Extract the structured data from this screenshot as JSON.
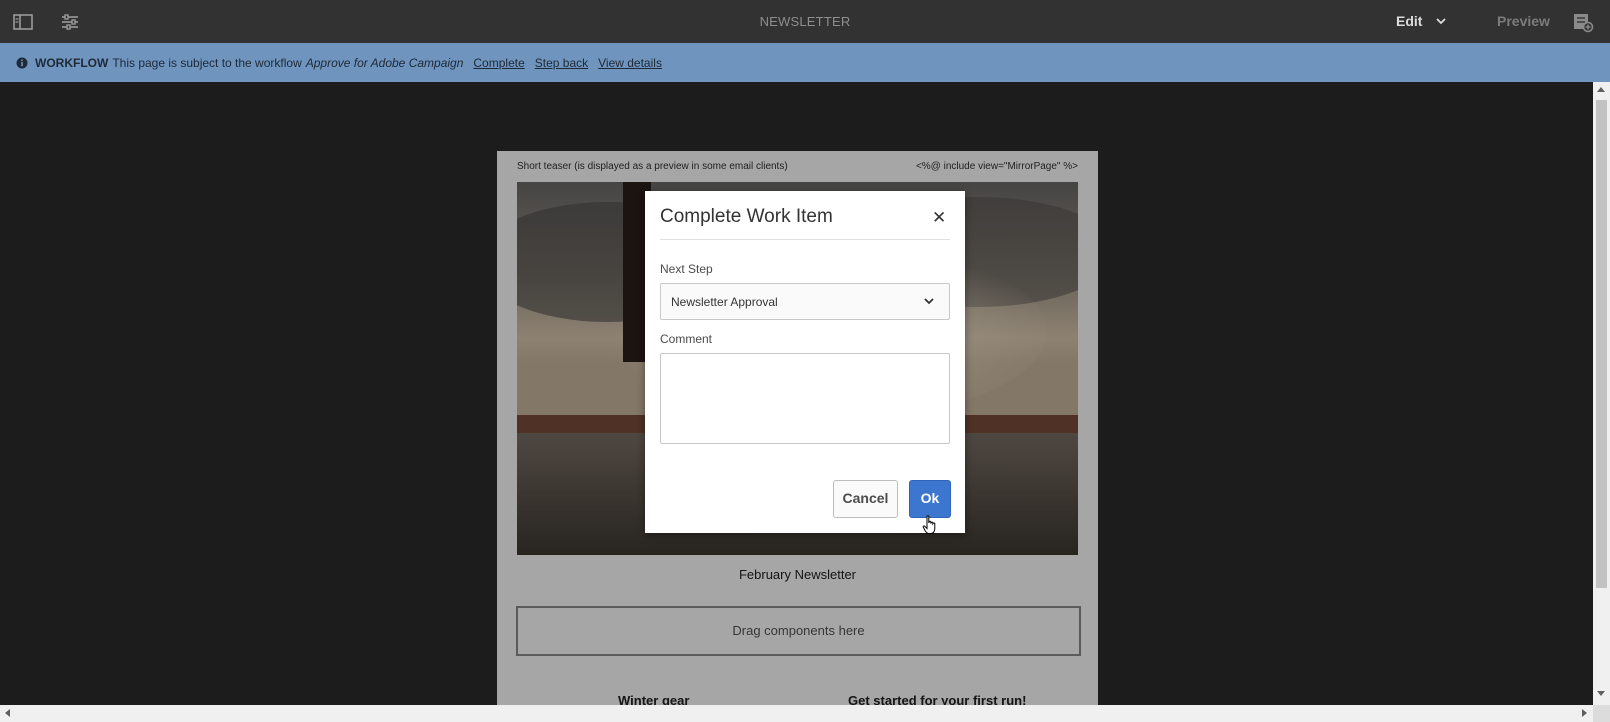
{
  "topbar": {
    "title": "NEWSLETTER",
    "edit_label": "Edit",
    "preview_label": "Preview",
    "icons": [
      "side-panel-icon",
      "page-properties-icon",
      "chevron-down-icon",
      "annotations-icon"
    ]
  },
  "workflow": {
    "label": "WORKFLOW",
    "text": "This page is subject to the workflow",
    "workflow_name": "Approve for Adobe Campaign",
    "links": {
      "complete": "Complete",
      "step_back": "Step back",
      "view_details": "View details"
    }
  },
  "page": {
    "teaser": "Short teaser (is displayed as a preview in some email clients)",
    "mirror": "<%@ include view=\"MirrorPage\" %>",
    "caption": "February Newsletter",
    "dropzone": "Drag components here",
    "col1": "Winter gear",
    "col2": "Get started for your first run!"
  },
  "dialog": {
    "title": "Complete Work Item",
    "next_step_label": "Next Step",
    "next_step_value": "Newsletter Approval",
    "comment_label": "Comment",
    "comment_value": "",
    "cancel_label": "Cancel",
    "ok_label": "Ok"
  },
  "colors": {
    "topbar": "#323232",
    "workflow_bar": "#6f94bd",
    "primary_button": "#3d76cf"
  }
}
